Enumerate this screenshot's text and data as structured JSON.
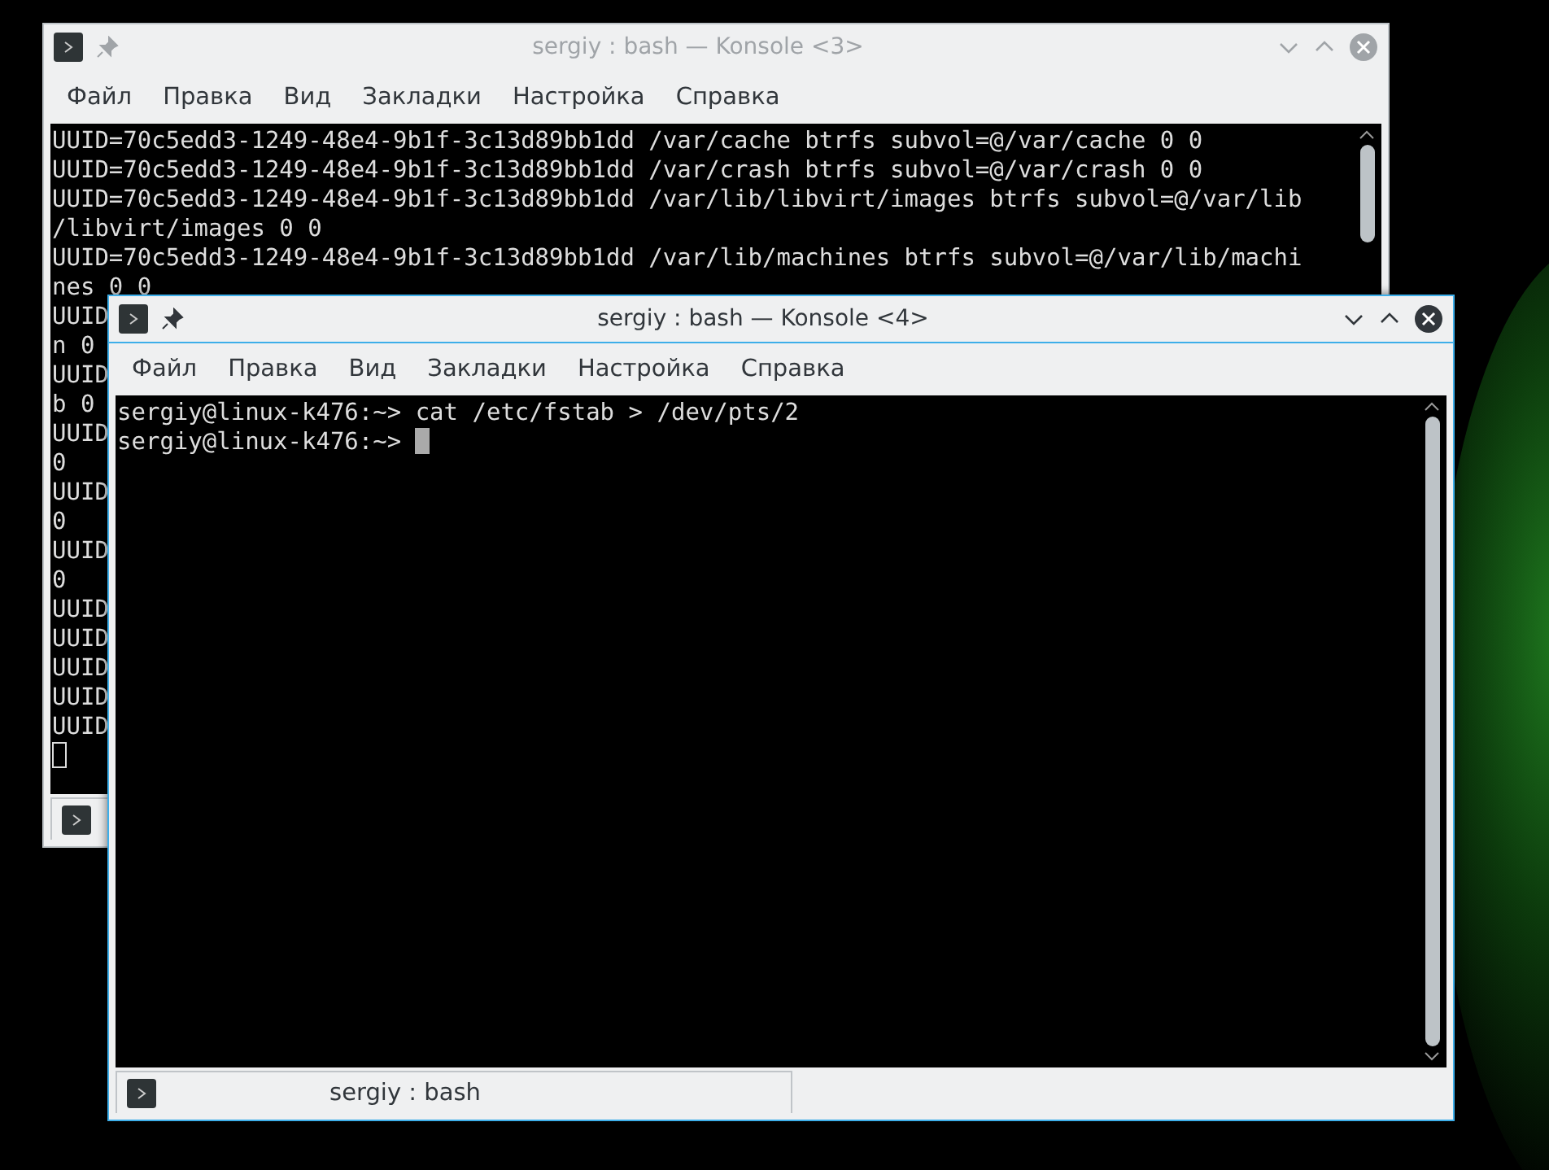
{
  "windows": [
    {
      "title": "sergiy : bash — Konsole <3>",
      "active": false,
      "menu": [
        "Файл",
        "Правка",
        "Вид",
        "Закладки",
        "Настройка",
        "Справка"
      ],
      "lines": [
        "UUID=70c5edd3-1249-48e4-9b1f-3c13d89bb1dd /var/cache btrfs subvol=@/var/cache 0 0",
        "UUID=70c5edd3-1249-48e4-9b1f-3c13d89bb1dd /var/crash btrfs subvol=@/var/crash 0 0",
        "UUID=70c5edd3-1249-48e4-9b1f-3c13d89bb1dd /var/lib/libvirt/images btrfs subvol=@/var/lib",
        "/libvirt/images 0 0",
        "UUID=70c5edd3-1249-48e4-9b1f-3c13d89bb1dd /var/lib/machines btrfs subvol=@/var/lib/machi",
        "nes 0 0",
        "UUID",
        "n 0",
        "UUID",
        "b 0",
        "UUID",
        "0",
        "UUID",
        "0",
        "UUID",
        "0",
        "UUID",
        "UUID",
        "UUID",
        "UUID",
        "UUID"
      ]
    },
    {
      "title": "sergiy : bash — Konsole <4>",
      "active": true,
      "menu": [
        "Файл",
        "Правка",
        "Вид",
        "Закладки",
        "Настройка",
        "Справка"
      ],
      "lines": [
        "sergiy@linux-k476:~> cat /etc/fstab > /dev/pts/2",
        "sergiy@linux-k476:~> "
      ],
      "tab": "sergiy : bash"
    }
  ]
}
